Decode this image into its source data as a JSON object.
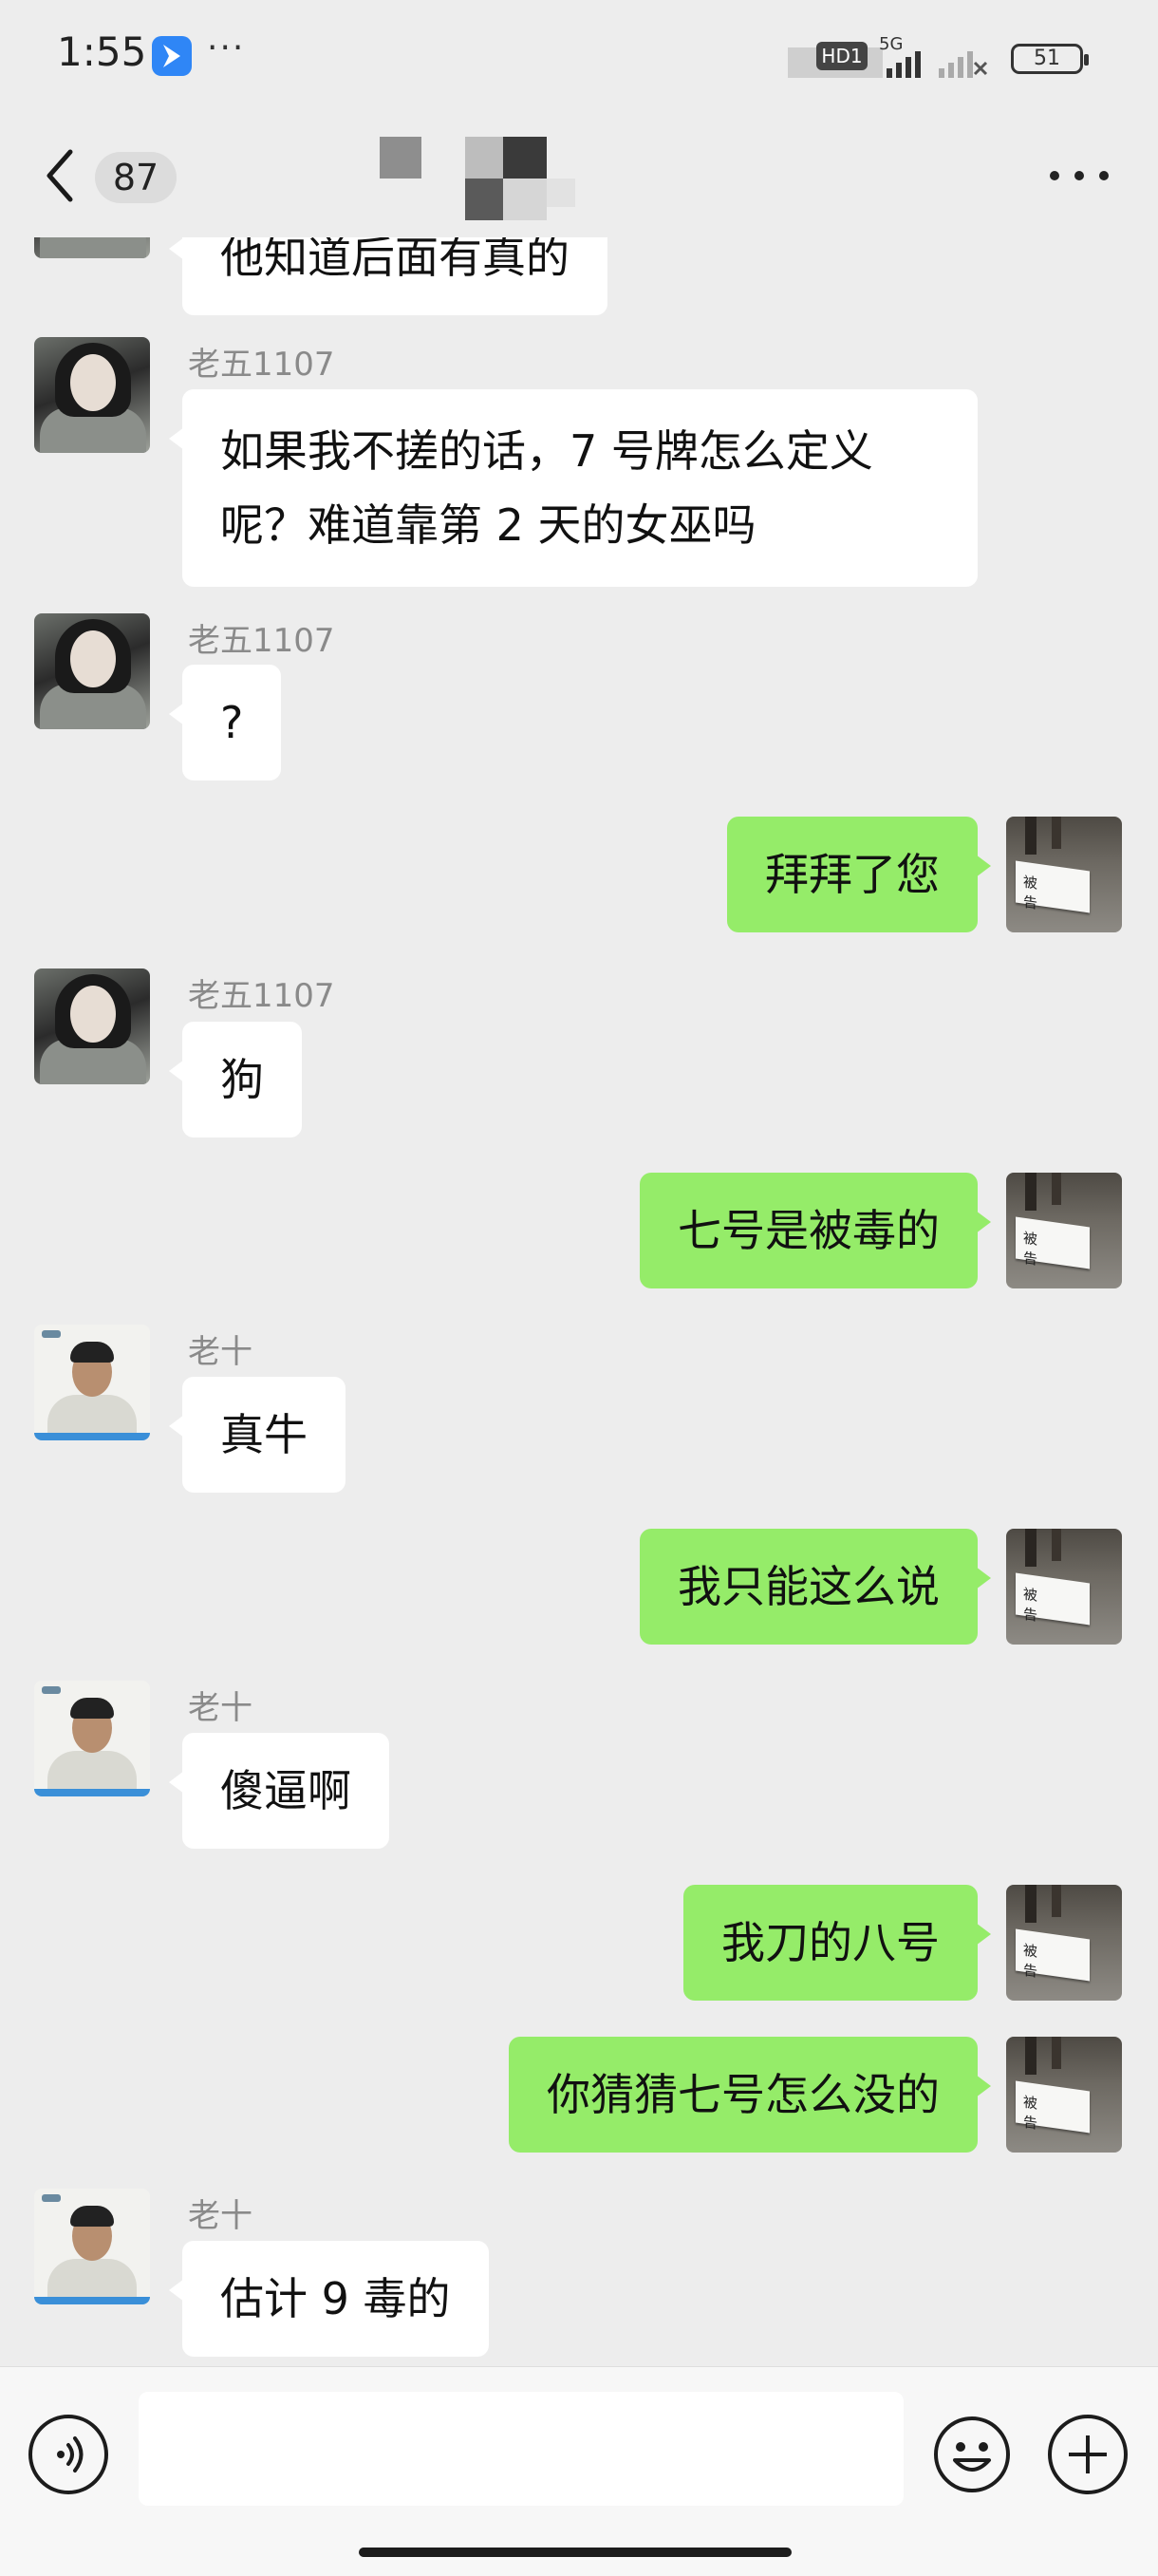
{
  "status_bar": {
    "time": "1:55",
    "dots": "···",
    "hd": "HD1",
    "network": "5G",
    "battery": "51"
  },
  "header": {
    "unread_count": "87",
    "title": ""
  },
  "colors": {
    "background": "#ededed",
    "incoming_bubble": "#ffffff",
    "outgoing_bubble": "#95ec69",
    "sender_name": "#8a8a8a"
  },
  "messages": [
    {
      "direction": "in",
      "sender": "",
      "text": "他知道后面有真的"
    },
    {
      "direction": "in",
      "sender": "老五1107",
      "text": "如果我不搓的话，7 号牌怎么定义呢？难道靠第 2 天的女巫吗"
    },
    {
      "direction": "in",
      "sender": "老五1107",
      "text": "?"
    },
    {
      "direction": "out",
      "sender": "",
      "text": "拜拜了您"
    },
    {
      "direction": "in",
      "sender": "老五1107",
      "text": "狗"
    },
    {
      "direction": "out",
      "sender": "",
      "text": "七号是被毒的"
    },
    {
      "direction": "in",
      "sender": "老十",
      "text": "真牛"
    },
    {
      "direction": "out",
      "sender": "",
      "text": "我只能这么说"
    },
    {
      "direction": "in",
      "sender": "老十",
      "text": "傻逼啊"
    },
    {
      "direction": "out",
      "sender": "",
      "text": "我刀的八号"
    },
    {
      "direction": "out",
      "sender": "",
      "text": "你猜猜七号怎么没的"
    },
    {
      "direction": "in",
      "sender": "老十",
      "text": "估计 9 毒的"
    }
  ],
  "my_avatar_plate_text": "被 告",
  "input": {
    "value": "",
    "placeholder": ""
  },
  "icons": {
    "back": "chevron-left-icon",
    "more": "more-dots-icon",
    "voice": "voice-icon",
    "emoji": "emoji-icon",
    "plus": "plus-icon"
  }
}
